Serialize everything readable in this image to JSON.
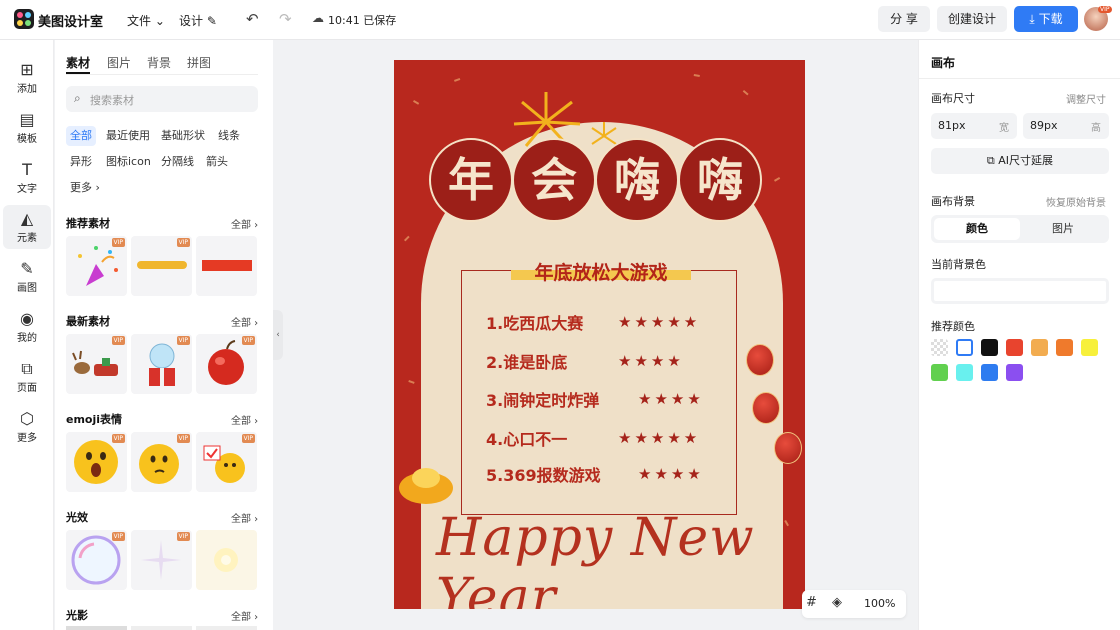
{
  "app": {
    "name": "美图设计室"
  },
  "menu": {
    "file": "文件",
    "design": "设计",
    "save_status": "10:41 已保存"
  },
  "toolbar": {
    "share": "分 享",
    "create": "创建设计",
    "download": "下载",
    "avatar_badge": "VIP"
  },
  "rail": {
    "items": [
      {
        "label": "添加",
        "icon": "plus-square-icon"
      },
      {
        "label": "模板",
        "icon": "template-icon"
      },
      {
        "label": "文字",
        "icon": "text-icon"
      },
      {
        "label": "元素",
        "icon": "shapes-icon"
      },
      {
        "label": "画图",
        "icon": "edit-icon"
      },
      {
        "label": "我的",
        "icon": "user-icon"
      },
      {
        "label": "页面",
        "icon": "page-add-icon"
      },
      {
        "label": "更多",
        "icon": "cube-icon"
      }
    ]
  },
  "panel": {
    "tabs": [
      "素材",
      "图片",
      "背景",
      "拼图"
    ],
    "search_placeholder": "搜索素材",
    "chips": [
      "全部",
      "最近使用",
      "基础形状",
      "线条",
      "异形",
      "图标icon",
      "分隔线",
      "箭头",
      "更多"
    ],
    "sections": [
      {
        "title": "推荐素材",
        "all": "全部"
      },
      {
        "title": "最新素材",
        "all": "全部"
      },
      {
        "title": "emoji表情",
        "all": "全部"
      },
      {
        "title": "光效",
        "all": "全部"
      },
      {
        "title": "光影",
        "all": "全部"
      }
    ],
    "vip_label": "VIP"
  },
  "poster": {
    "title_chars": [
      "年",
      "会",
      "嗨",
      "嗨"
    ],
    "subtitle": "年底放松大游戏",
    "games": [
      "1.吃西瓜大赛",
      "2.谁是卧底",
      "3.闹钟定时炸弹",
      "4.心口不一",
      "5.369报数游戏"
    ],
    "stars": [
      "★★★★★",
      "★★★★",
      "★★★★",
      "★★★★★",
      "★★★★"
    ],
    "script_text": "Happy New Year"
  },
  "zoom": {
    "value": "100%"
  },
  "props": {
    "title": "画布",
    "size_label": "画布尺寸",
    "size_adjust": "调整尺寸",
    "width_value": "81px",
    "width_unit": "宽",
    "height_value": "89px",
    "height_unit": "高",
    "ai_button": "AI尺寸延展",
    "bg_label": "画布背景",
    "bg_restore": "恢复原始背景",
    "bg_tabs": [
      "颜色",
      "图片"
    ],
    "current_bg_label": "当前背景色",
    "recommended_label": "推荐颜色",
    "swatches": [
      "transparent",
      "#ffffff",
      "#111111",
      "#e8442e",
      "#f2ac50",
      "#ef7a2c",
      "#f7f03b",
      "#61d04f",
      "#69f0ee",
      "#2e7cf0",
      "#8b4ff0"
    ]
  }
}
